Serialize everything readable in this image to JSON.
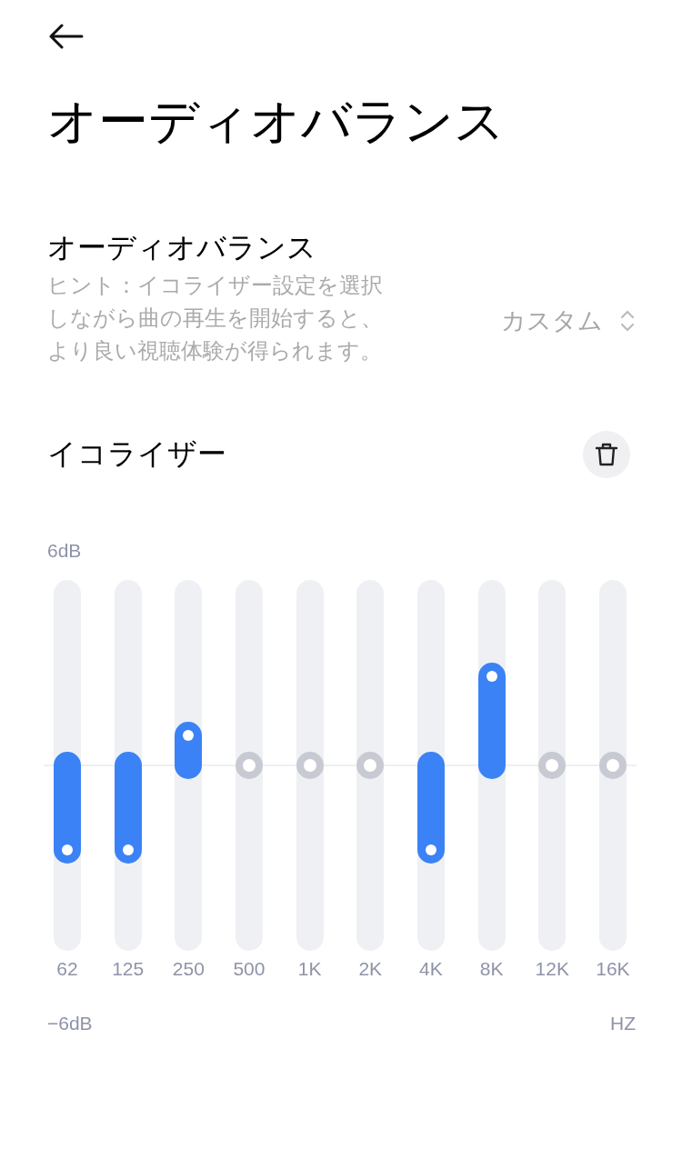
{
  "page": {
    "title": "オーディオバランス"
  },
  "balance": {
    "title": "オーディオバランス",
    "hint": "ヒント：イコライザー設定を選択しながら曲の再生を開始すると、より良い視聴体験が得られます。",
    "preset": "カスタム"
  },
  "equalizer": {
    "title": "イコライザー",
    "max_label": "6dB",
    "min_label": "−6dB",
    "unit_label": "HZ",
    "bands": [
      {
        "label": "62",
        "level": 0.27
      },
      {
        "label": "125",
        "level": 0.27
      },
      {
        "label": "250",
        "level": 0.58
      },
      {
        "label": "500",
        "level": 0.5
      },
      {
        "label": "1K",
        "level": 0.5
      },
      {
        "label": "2K",
        "level": 0.5
      },
      {
        "label": "4K",
        "level": 0.27
      },
      {
        "label": "8K",
        "level": 0.74
      },
      {
        "label": "12K",
        "level": 0.5
      },
      {
        "label": "16K",
        "level": 0.5
      }
    ]
  }
}
